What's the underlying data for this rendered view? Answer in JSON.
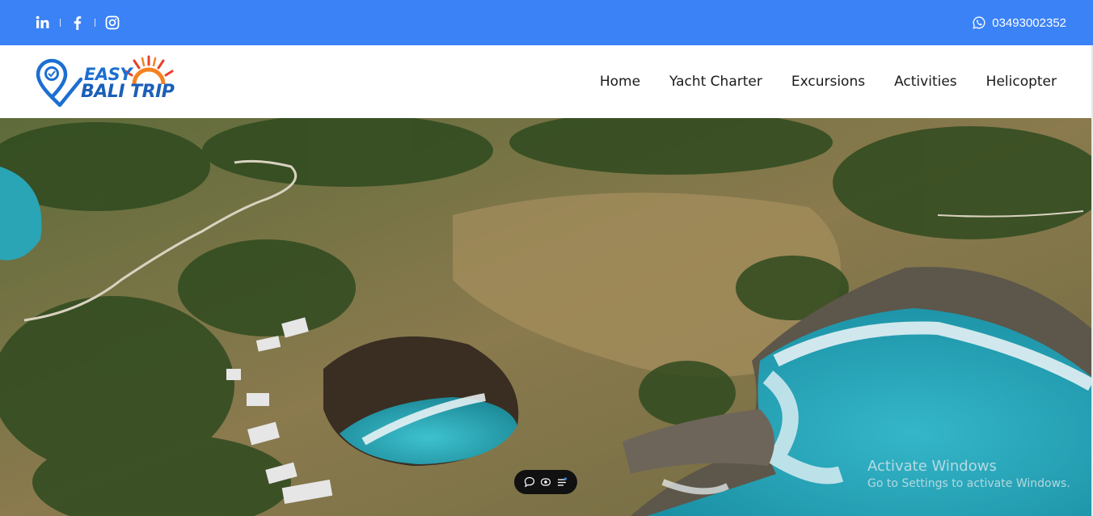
{
  "topbar": {
    "bg_color": "#3b82f6",
    "socials": [
      "linkedin-icon",
      "facebook-icon",
      "instagram-icon"
    ],
    "phone_icon": "whatsapp-icon",
    "phone": "03493002352"
  },
  "brand": {
    "line1": "EASY",
    "line2": "BALI TRIP",
    "primary_color": "#1d6fd1",
    "sun_color": "#f58220"
  },
  "nav": {
    "items": [
      "Home",
      "Yacht Charter",
      "Excursions",
      "Activities",
      "Helicopter"
    ]
  },
  "hero": {
    "image": "aerial-view-of-coastline-with-broken-beach-lagoon"
  },
  "player_controls": [
    "comment-icon",
    "eye-icon",
    "menu-icon"
  ],
  "watermark": {
    "title": "Activate Windows",
    "subtitle": "Go to Settings to activate Windows."
  }
}
